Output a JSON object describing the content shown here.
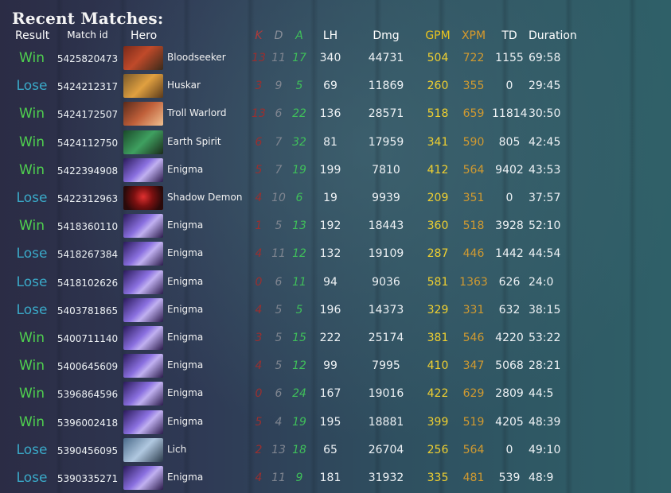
{
  "title": "Recent Matches:",
  "headers": {
    "result": "Result",
    "match_id": "Match id",
    "hero": "Hero",
    "k": "K",
    "d": "D",
    "a": "A",
    "lh": "LH",
    "dmg": "Dmg",
    "gpm": "GPM",
    "xpm": "XPM",
    "td": "TD",
    "duration": "Duration"
  },
  "colors": {
    "win": "#4fd04f",
    "lose": "#3aa9c8",
    "kills": "#9a2f2f",
    "deaths": "#7f8590",
    "assists": "#3fbf5a",
    "gpm": "#f0d030",
    "xpm": "#d19a30"
  },
  "matches": [
    {
      "result": "Win",
      "match_id": "5425820473",
      "hero": "Bloodseeker",
      "portrait": "bloodseeker",
      "k": "13",
      "d": "11",
      "a": "17",
      "lh": "340",
      "dmg": "44731",
      "gpm": "504",
      "xpm": "722",
      "td": "1155",
      "duration": "69:58"
    },
    {
      "result": "Lose",
      "match_id": "5424212317",
      "hero": "Huskar",
      "portrait": "huskar",
      "k": "3",
      "d": "9",
      "a": "5",
      "lh": "69",
      "dmg": "11869",
      "gpm": "260",
      "xpm": "355",
      "td": "0",
      "duration": "29:45"
    },
    {
      "result": "Win",
      "match_id": "5424172507",
      "hero": "Troll Warlord",
      "portrait": "troll",
      "k": "13",
      "d": "6",
      "a": "22",
      "lh": "136",
      "dmg": "28571",
      "gpm": "518",
      "xpm": "659",
      "td": "11814",
      "duration": "30:50"
    },
    {
      "result": "Win",
      "match_id": "5424112750",
      "hero": "Earth Spirit",
      "portrait": "earth",
      "k": "6",
      "d": "7",
      "a": "32",
      "lh": "81",
      "dmg": "17959",
      "gpm": "341",
      "xpm": "590",
      "td": "805",
      "duration": "42:45"
    },
    {
      "result": "Win",
      "match_id": "5422394908",
      "hero": "Enigma",
      "portrait": "enigma",
      "k": "5",
      "d": "7",
      "a": "19",
      "lh": "199",
      "dmg": "7810",
      "gpm": "412",
      "xpm": "564",
      "td": "9402",
      "duration": "43:53"
    },
    {
      "result": "Lose",
      "match_id": "5422312963",
      "hero": "Shadow Demon",
      "portrait": "shadow",
      "k": "4",
      "d": "10",
      "a": "6",
      "lh": "19",
      "dmg": "9939",
      "gpm": "209",
      "xpm": "351",
      "td": "0",
      "duration": "37:57"
    },
    {
      "result": "Win",
      "match_id": "5418360110",
      "hero": "Enigma",
      "portrait": "enigma",
      "k": "1",
      "d": "5",
      "a": "13",
      "lh": "192",
      "dmg": "18443",
      "gpm": "360",
      "xpm": "518",
      "td": "3928",
      "duration": "52:10"
    },
    {
      "result": "Lose",
      "match_id": "5418267384",
      "hero": "Enigma",
      "portrait": "enigma",
      "k": "4",
      "d": "11",
      "a": "12",
      "lh": "132",
      "dmg": "19109",
      "gpm": "287",
      "xpm": "446",
      "td": "1442",
      "duration": "44:54"
    },
    {
      "result": "Lose",
      "match_id": "5418102626",
      "hero": "Enigma",
      "portrait": "enigma",
      "k": "0",
      "d": "6",
      "a": "11",
      "lh": "94",
      "dmg": "9036",
      "gpm": "581",
      "xpm": "1363",
      "td": "626",
      "duration": "24:0"
    },
    {
      "result": "Lose",
      "match_id": "5403781865",
      "hero": "Enigma",
      "portrait": "enigma",
      "k": "4",
      "d": "5",
      "a": "5",
      "lh": "196",
      "dmg": "14373",
      "gpm": "329",
      "xpm": "331",
      "td": "632",
      "duration": "38:15"
    },
    {
      "result": "Win",
      "match_id": "5400711140",
      "hero": "Enigma",
      "portrait": "enigma",
      "k": "3",
      "d": "5",
      "a": "15",
      "lh": "222",
      "dmg": "25174",
      "gpm": "381",
      "xpm": "546",
      "td": "4220",
      "duration": "53:22"
    },
    {
      "result": "Win",
      "match_id": "5400645609",
      "hero": "Enigma",
      "portrait": "enigma",
      "k": "4",
      "d": "5",
      "a": "12",
      "lh": "99",
      "dmg": "7995",
      "gpm": "410",
      "xpm": "347",
      "td": "5068",
      "duration": "28:21"
    },
    {
      "result": "Win",
      "match_id": "5396864596",
      "hero": "Enigma",
      "portrait": "enigma",
      "k": "0",
      "d": "6",
      "a": "24",
      "lh": "167",
      "dmg": "19016",
      "gpm": "422",
      "xpm": "629",
      "td": "2809",
      "duration": "44:5"
    },
    {
      "result": "Win",
      "match_id": "5396002418",
      "hero": "Enigma",
      "portrait": "enigma",
      "k": "5",
      "d": "4",
      "a": "19",
      "lh": "195",
      "dmg": "18881",
      "gpm": "399",
      "xpm": "519",
      "td": "4205",
      "duration": "48:39"
    },
    {
      "result": "Lose",
      "match_id": "5390456095",
      "hero": "Lich",
      "portrait": "lich",
      "k": "2",
      "d": "13",
      "a": "18",
      "lh": "65",
      "dmg": "26704",
      "gpm": "256",
      "xpm": "564",
      "td": "0",
      "duration": "49:10"
    },
    {
      "result": "Lose",
      "match_id": "5390335271",
      "hero": "Enigma",
      "portrait": "enigma",
      "k": "4",
      "d": "11",
      "a": "9",
      "lh": "181",
      "dmg": "31932",
      "gpm": "335",
      "xpm": "481",
      "td": "539",
      "duration": "48:9"
    }
  ]
}
